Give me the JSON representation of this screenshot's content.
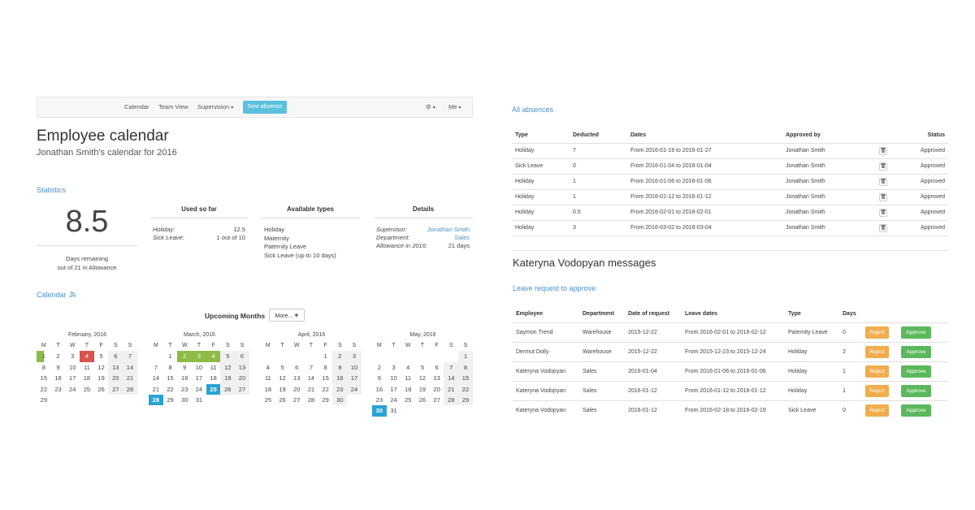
{
  "nav": {
    "calendar": "Calendar",
    "team_view": "Team View",
    "supervision": "Supervision",
    "new_absence": "New absence",
    "settings": "⚙",
    "me": "Me"
  },
  "header": {
    "title": "Employee calendar",
    "subtitle": "Jonathan Smith's calendar for 2016"
  },
  "statistics": {
    "link": "Statistics",
    "days_remaining": "8.5",
    "caption_line1": "Days remaining",
    "caption_line2": "out of 21 in Allowance",
    "used_so_far": {
      "heading": "Used so far",
      "holiday_label": "Holiday:",
      "holiday_value": "12.5",
      "sick_label": "Sick Leave:",
      "sick_value": "1 out of 10"
    },
    "available_types": {
      "heading": "Available types",
      "items": [
        "Holiday",
        "Maternity",
        "Paternity Leave",
        "Sick Leave (up to 10 days)"
      ]
    },
    "details": {
      "heading": "Details",
      "supervisor_label": "Supervisor:",
      "supervisor_value": "Jonathan Smith",
      "department_label": "Department:",
      "department_value": "Sales",
      "allowance_label": "Allowance in 2016:",
      "allowance_value": "21 days"
    }
  },
  "calendar": {
    "link": "Calendar",
    "rss_icon": "rss-icon",
    "upcoming": "Upcoming Months",
    "more_button": "More...",
    "day_headers": [
      "M",
      "T",
      "W",
      "T",
      "F",
      "S",
      "S"
    ],
    "months": [
      {
        "title": "February, 2016",
        "offset": 0,
        "days": 29,
        "marks": {
          "1": "gh",
          "4": "r"
        }
      },
      {
        "title": "March, 2016",
        "offset": 1,
        "days": 31,
        "marks": {
          "2": "g",
          "3": "g",
          "4": "g",
          "25": "b",
          "28": "b"
        }
      },
      {
        "title": "April, 2016",
        "offset": 4,
        "days": 30,
        "marks": {}
      },
      {
        "title": "May, 2016",
        "offset": 6,
        "days": 31,
        "marks": {
          "30": "b"
        }
      }
    ]
  },
  "absences": {
    "link": "All absences",
    "headers": [
      "Type",
      "Deducted",
      "Dates",
      "Approved by",
      "",
      "Status"
    ],
    "rows": [
      [
        "Holiday",
        "7",
        "From 2016-01-19 to 2016-01-27",
        "Jonathan Smith",
        "Approved"
      ],
      [
        "Sick Leave",
        "0",
        "From 2016-01-04 to 2016-01-04",
        "Jonathan Smith",
        "Approved"
      ],
      [
        "Holiday",
        "1",
        "From 2016-01-06 to 2016-01-06",
        "Jonathan Smith",
        "Approved"
      ],
      [
        "Holiday",
        "1",
        "From 2016-01-12 to 2016-01-12",
        "Jonathan Smith",
        "Approved"
      ],
      [
        "Holiday",
        "0.5",
        "From 2016-02-01 to 2016-02-01",
        "Jonathan Smith",
        "Approved"
      ],
      [
        "Holiday",
        "3",
        "From 2016-03-02 to 2016-03-04",
        "Jonathan Smith",
        "Approved"
      ]
    ]
  },
  "messages": {
    "title": "Kateryna Vodopyan messages",
    "link": "Leave request to approve",
    "headers": [
      "Employee",
      "Department",
      "Date of request",
      "Leave dates",
      "Type",
      "Days",
      "",
      ""
    ],
    "reject_label": "Reject",
    "approve_label": "Approve",
    "rows": [
      [
        "Saymon Trend",
        "Warehouse",
        "2015-12-22",
        "From 2016-02-01 to 2016-02-12",
        "Paternity Leave",
        "0"
      ],
      [
        "Dermut Dolly",
        "Warehouse",
        "2015-12-22",
        "From 2015-12-23 to 2015-12-24",
        "Holiday",
        "2"
      ],
      [
        "Kateryna Vodopyan",
        "Sales",
        "2016-01-04",
        "From 2016-01-06 to 2016-01-06",
        "Holiday",
        "1"
      ],
      [
        "Kateryna Vodopyan",
        "Sales",
        "2016-01-12",
        "From 2016-01-12 to 2016-01-12",
        "Holiday",
        "1"
      ],
      [
        "Kateryna Vodopyan",
        "Sales",
        "2016-01-12",
        "From 2016-02-18 to 2016-02-19",
        "Sick Leave",
        "0"
      ]
    ]
  }
}
